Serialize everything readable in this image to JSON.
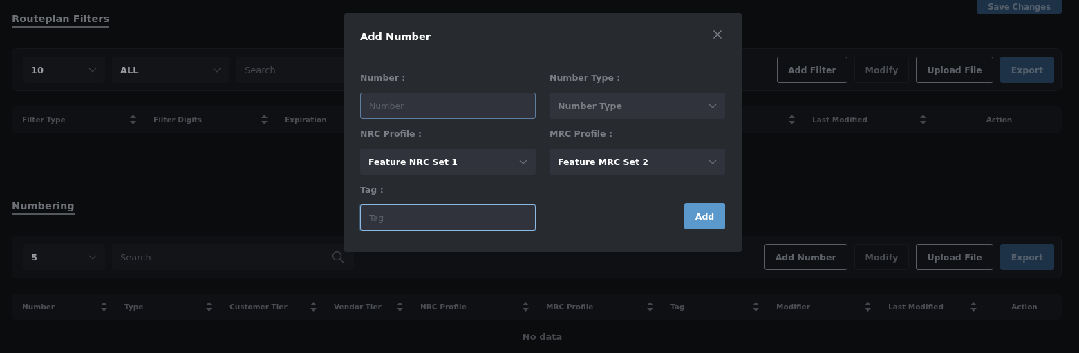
{
  "header_button": {
    "label": "Save Changes",
    "kind": "primary"
  },
  "routeplan_filters": {
    "title": "Routeplan Filters",
    "toolbar": {
      "controls": [
        {
          "kind": "select",
          "value": "10"
        },
        {
          "kind": "select",
          "value": "ALL"
        },
        {
          "kind": "search",
          "placeholder": "Search"
        }
      ],
      "buttons": [
        {
          "label": "Add Filter",
          "kind": "outline"
        },
        {
          "label": "Modify",
          "kind": "disabled"
        },
        {
          "label": "Upload File",
          "kind": "outline"
        },
        {
          "label": "Export",
          "kind": "primary"
        }
      ]
    },
    "table": {
      "columns": [
        {
          "label": "Filter Type",
          "sortable": true
        },
        {
          "label": "Filter Digits",
          "sortable": true
        },
        {
          "label": "Expiration",
          "sortable": false
        },
        {
          "sortable": true
        },
        {
          "label": "Last Modified",
          "sortable": true
        },
        {
          "label": "Action",
          "sortable": false
        }
      ]
    }
  },
  "numbering": {
    "title": "Numbering",
    "toolbar": {
      "controls": [
        {
          "kind": "select",
          "value": "5"
        },
        {
          "kind": "search",
          "placeholder": "Search"
        }
      ],
      "buttons": [
        {
          "label": "Add Number",
          "kind": "outline"
        },
        {
          "label": "Modify",
          "kind": "disabled"
        },
        {
          "label": "Upload File",
          "kind": "outline"
        },
        {
          "label": "Export",
          "kind": "primary"
        }
      ]
    },
    "table": {
      "columns": [
        {
          "label": "Number",
          "sortable": true
        },
        {
          "label": "Type",
          "sortable": true
        },
        {
          "label": "Customer Tier",
          "sortable": true
        },
        {
          "label": "Vendor Tier",
          "sortable": true
        },
        {
          "label": "NRC Profile",
          "sortable": true
        },
        {
          "label": "MRC Profile",
          "sortable": true
        },
        {
          "label": "Tag",
          "sortable": true
        },
        {
          "label": "Modifier",
          "sortable": true
        },
        {
          "label": "Last Modified",
          "sortable": true
        },
        {
          "label": "Action",
          "sortable": false
        }
      ],
      "empty_text": "No data"
    }
  },
  "dialog": {
    "title": "Add Number",
    "fields": [
      {
        "label": "Number :",
        "kind": "input",
        "placeholder": "Number",
        "focused": false
      },
      {
        "label": "Number Type :",
        "kind": "select",
        "placeholder": "Number Type"
      },
      {
        "label": "NRC Profile :",
        "kind": "select",
        "value": "Feature NRC Set 1"
      },
      {
        "label": "MRC Profile :",
        "kind": "select",
        "value": "Feature MRC Set 2"
      },
      {
        "label": "Tag :",
        "kind": "input",
        "placeholder": "Tag",
        "focused": true
      }
    ],
    "submit": "Add"
  }
}
